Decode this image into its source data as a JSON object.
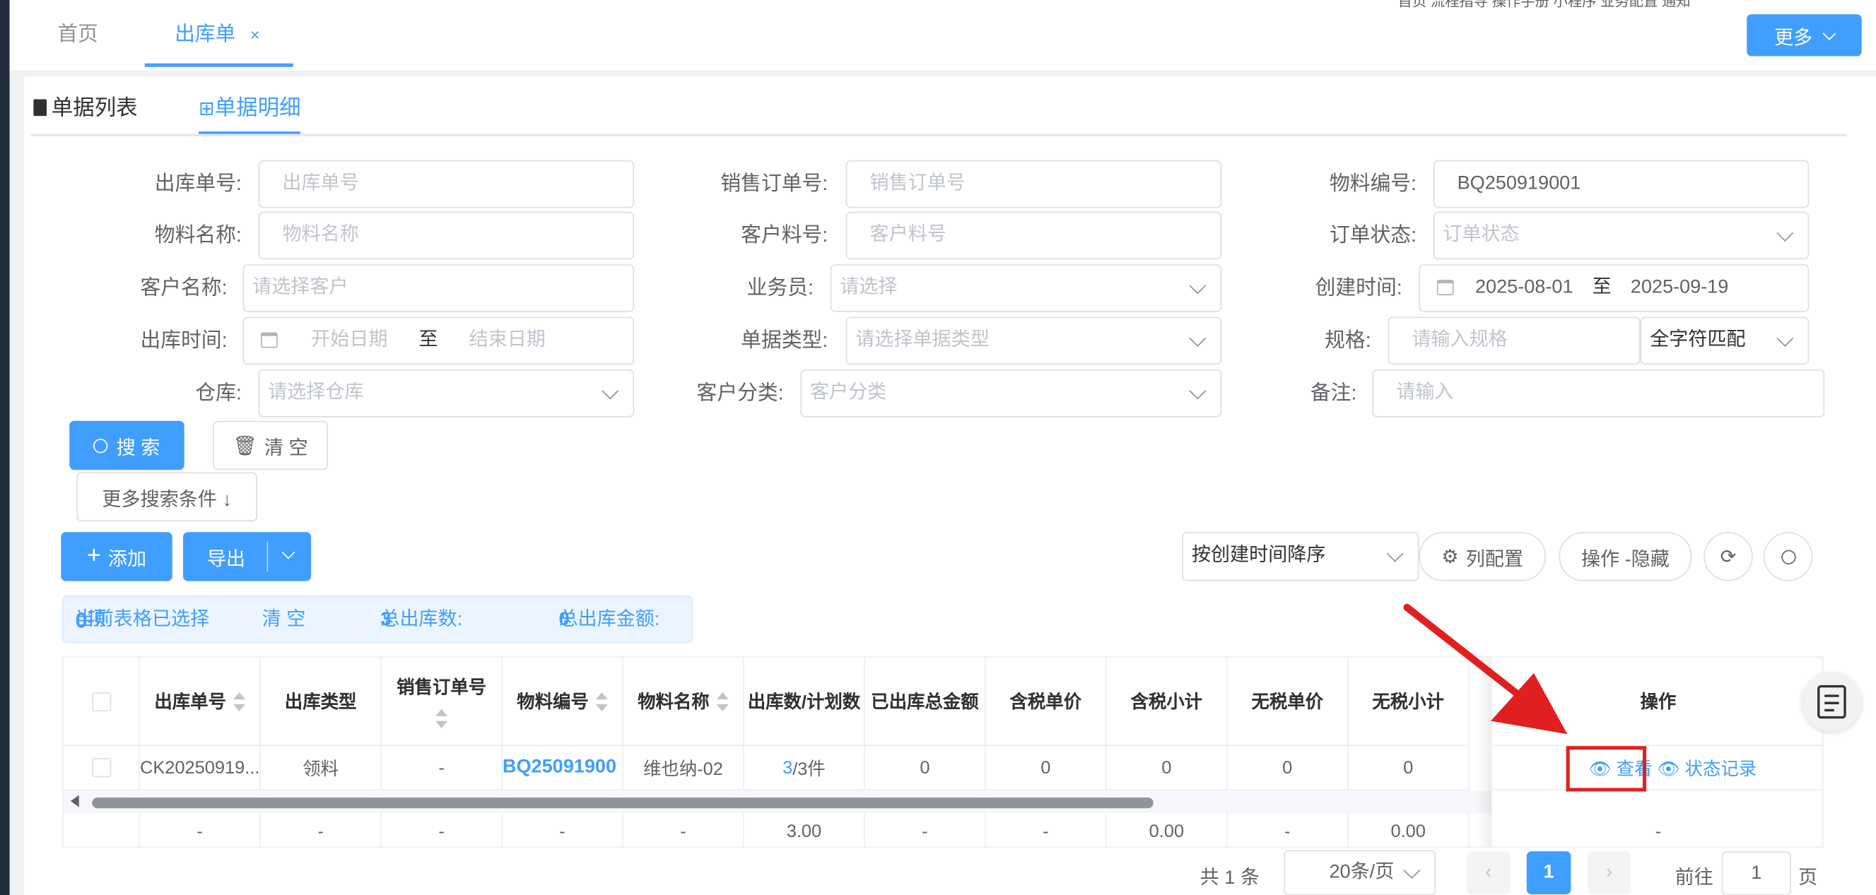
{
  "topnav": {
    "links": "首页   流程指导  操作手册  小程序  业务配置  通知",
    "tabs": [
      {
        "label": "首页"
      },
      {
        "label": "出库单",
        "close": "×"
      }
    ],
    "more_label": "更多"
  },
  "subtabs": {
    "list": "单据列表",
    "detail": "单据明细"
  },
  "filters": {
    "outbound_no": {
      "label": "出库单号:",
      "placeholder": "出库单号"
    },
    "sales_order_no": {
      "label": "销售订单号:",
      "placeholder": "销售订单号"
    },
    "material_code": {
      "label": "物料编号:",
      "value": "BQ250919001"
    },
    "material_name": {
      "label": "物料名称:",
      "placeholder": "物料名称"
    },
    "customer_part_no": {
      "label": "客户料号:",
      "placeholder": "客户料号"
    },
    "order_status": {
      "label": "订单状态:",
      "placeholder": "订单状态"
    },
    "customer_name": {
      "label": "客户名称:",
      "placeholder": "请选择客户"
    },
    "salesperson": {
      "label": "业务员:",
      "placeholder": "请选择"
    },
    "create_time": {
      "label": "创建时间:",
      "start": "2025-08-01",
      "sep": "至",
      "end": "2025-09-19"
    },
    "outbound_time": {
      "label": "出库时间:",
      "start": "开始日期",
      "sep": "至",
      "end": "结束日期"
    },
    "doc_type": {
      "label": "单据类型:",
      "placeholder": "请选择单据类型"
    },
    "spec": {
      "label": "规格:",
      "placeholder": "请输入规格",
      "match": "全字符匹配"
    },
    "warehouse": {
      "label": "仓库:",
      "placeholder": "请选择仓库"
    },
    "customer_category": {
      "label": "客户分类:",
      "placeholder": "客户分类"
    },
    "remark": {
      "label": "备注:",
      "placeholder": "请输入"
    }
  },
  "actions": {
    "search": "搜 索",
    "clear": "清 空",
    "more_conditions": "更多搜索条件 ↓",
    "add": "添加",
    "export": "导出",
    "sort": "按创建时间降序",
    "column_config": "列配置",
    "op_hide": "操作 -隐藏"
  },
  "selection_info": {
    "selected_prefix": "当前表格已选择",
    "selected_count": "0",
    "selected_suffix": "项",
    "clear": "清 空",
    "total_qty_label": "总出库数:",
    "total_qty": "3",
    "total_amount_label": "总出库金额:",
    "total_amount": "0"
  },
  "table": {
    "headers": [
      "出库单号",
      "出库类型",
      "销售订单号",
      "物料编号",
      "物料名称",
      "出库数/计划数",
      "已出库总金额",
      "含税单价",
      "含税小计",
      "无税单价",
      "无税小计",
      "操作"
    ],
    "row": {
      "outbound_no": "CK20250919...",
      "type": "领料",
      "sales_order": "-",
      "material_code": "BQ25091900",
      "material_name": "维也纳-02",
      "qty_done": "3",
      "qty_plan": "/3件",
      "shipped_amount": "0",
      "tax_price": "0",
      "tax_subtotal": "0",
      "notax_price": "0",
      "notax_subtotal": "0",
      "op_view": "查看",
      "op_status": "状态记录"
    },
    "footer": [
      "-",
      "-",
      "-",
      "-",
      "-",
      "3.00",
      "-",
      "-",
      "0.00",
      "-",
      "0.00",
      "-"
    ]
  },
  "pagination": {
    "total": "共 1 条",
    "page_size": "20条/页",
    "current": "1",
    "goto_prefix": "前往",
    "goto_value": "1",
    "goto_suffix": "页"
  },
  "colors": {
    "primary": "#409eff",
    "annotation": "#e02020"
  }
}
